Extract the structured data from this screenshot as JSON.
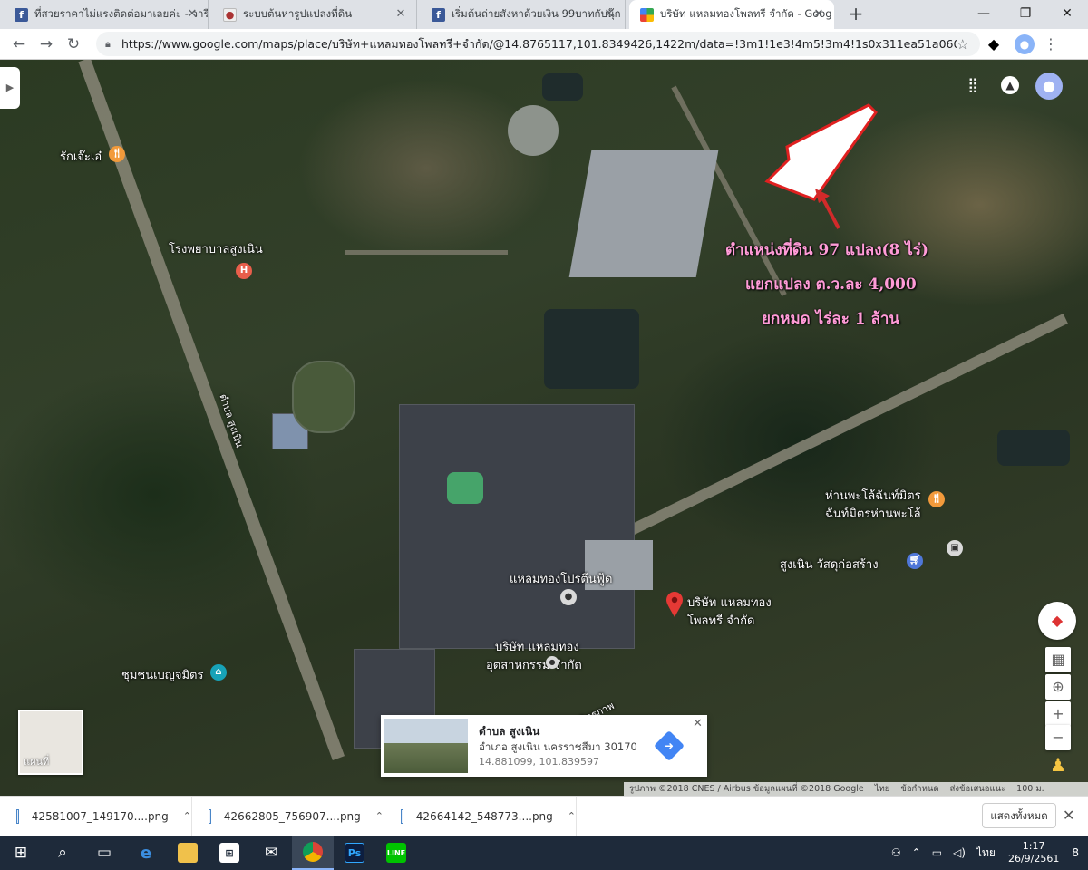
{
  "browser": {
    "tabs": [
      {
        "label": "ที่สวยราคาไม่แรงติดต่อมาเลยค่ะ - วารีจ์",
        "icon": "facebook-icon",
        "active": false
      },
      {
        "label": "ระบบต้นหารูปแปลงที่ดิน",
        "icon": "dol-icon",
        "active": false
      },
      {
        "label": "เริ่มต้นถ่ายสังหาด้วยเงิน 99บาทกับนุ๊ก",
        "icon": "facebook-icon",
        "active": false
      },
      {
        "label": "บริษัท แหลมทองโพลทรี จำกัด - Goog",
        "icon": "google-maps-icon",
        "active": true
      }
    ],
    "new_tab": "+",
    "window_controls": {
      "minimize": "—",
      "restore": "❐",
      "close": "✕"
    },
    "url": "https://www.google.com/maps/place/บริษัท+แหลมทองโพลทรี+จำกัด/@14.8765117,101.8349426,1422m/data=!3m1!1e3!4m5!3m4!1s0x311ea51a060c99eb:0xa..."
  },
  "map": {
    "labels": [
      {
        "text": "รักเจ๊ะเอ๋",
        "poi": "orange"
      },
      {
        "text": "โรงพยาบาลสูงเนิน",
        "poi": "red"
      },
      {
        "text": "ตำบล สูงเนิน"
      },
      {
        "text": "ร้านพะโล้ฉันท์มิตร ฉันท์มิตรร้านพะโล้",
        "line1": "ห่านพะโล้ฉันท์มิตร",
        "line2": "ฉันท์มิตรห่านพะโล้",
        "poi": "orange"
      },
      {
        "text": "สูงเนิน วัสดุก่อสร้าง",
        "poi": "blue"
      },
      {
        "text": "แหลมทองโปรตีนฟู้ด",
        "poi": "gray"
      },
      {
        "text": "บริษัท แหลมทอง โพลทรี จำกัด",
        "line1": "บริษัท แหลมทอง",
        "line2": "โพลทรี จำกัด"
      },
      {
        "text": "บริษัท แหลมทอง อุตสาหกรรม จำกัด",
        "line1": "บริษัท แหลมทอง",
        "line2": "อุตสาหกรรม จำกัด"
      },
      {
        "text": "ชุมชนเบญจมิตร",
        "poi": "teal"
      },
      {
        "text": "ถนนมิตรภาพ"
      }
    ],
    "annotation": {
      "line1": "ตำแหน่งที่ดิน 97 แปลง(8 ไร่)",
      "line2": "แยกแปลง ต.ว.ละ 4,000",
      "line3": "ยกหมด ไร่ละ 1 ล้าน"
    },
    "layer_label": "แผนที่",
    "info_card": {
      "title": "ตำบล สูงเนิน",
      "address": "อำเภอ สูงเนิน นครราชสีมา 30170",
      "coords": "14.881099, 101.839597"
    },
    "footer": {
      "imagery": "รูปภาพ ©2018 CNES / Airbus ข้อมูลแผนที่ ©2018 Google",
      "lang": "ไทย",
      "terms": "ข้อกำหนด",
      "feedback": "ส่งข้อเสนอแนะ",
      "scale": "100 ม."
    }
  },
  "downloads": {
    "items": [
      "42581007_149170....png",
      "42662805_756907....png",
      "42664142_548773....png"
    ],
    "show_all": "แสดงทั้งหมด"
  },
  "taskbar": {
    "lang": "ไทย",
    "time": "1:17",
    "date": "26/9/2561",
    "notifications": "8"
  },
  "colors": {
    "annotation": "#ff9bd7",
    "plot_outline": "#e02020",
    "pin": "#e53935"
  }
}
